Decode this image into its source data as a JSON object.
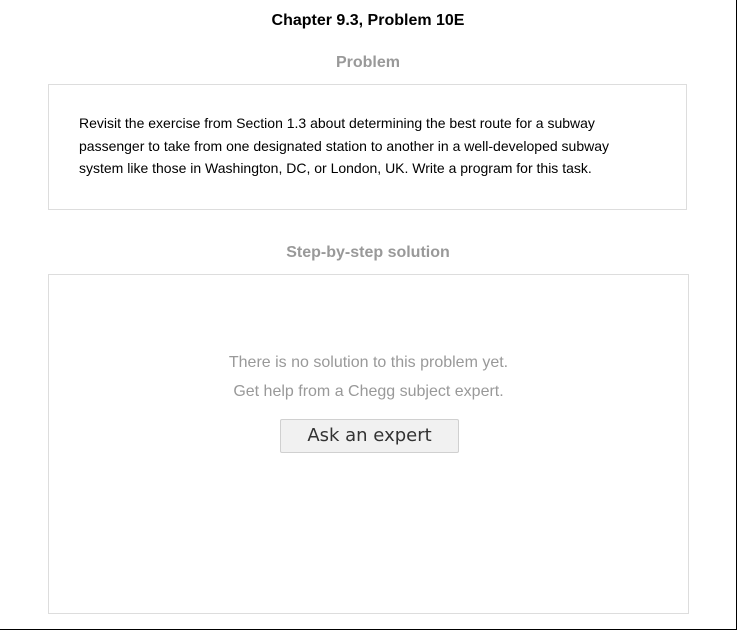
{
  "header": {
    "chapter_title": "Chapter 9.3, Problem 10E"
  },
  "problem": {
    "heading": "Problem",
    "text": "Revisit the exercise from Section 1.3 about determining the best route for a subway passenger to take from one designated station to another in a well-developed subway system like those in Washington, DC, or London, UK. Write a program for this task."
  },
  "solution": {
    "heading": "Step-by-step solution",
    "no_solution_message": "There is no solution to this problem yet.",
    "help_message": "Get help from a Chegg subject expert.",
    "ask_button_label": "Ask an expert"
  }
}
